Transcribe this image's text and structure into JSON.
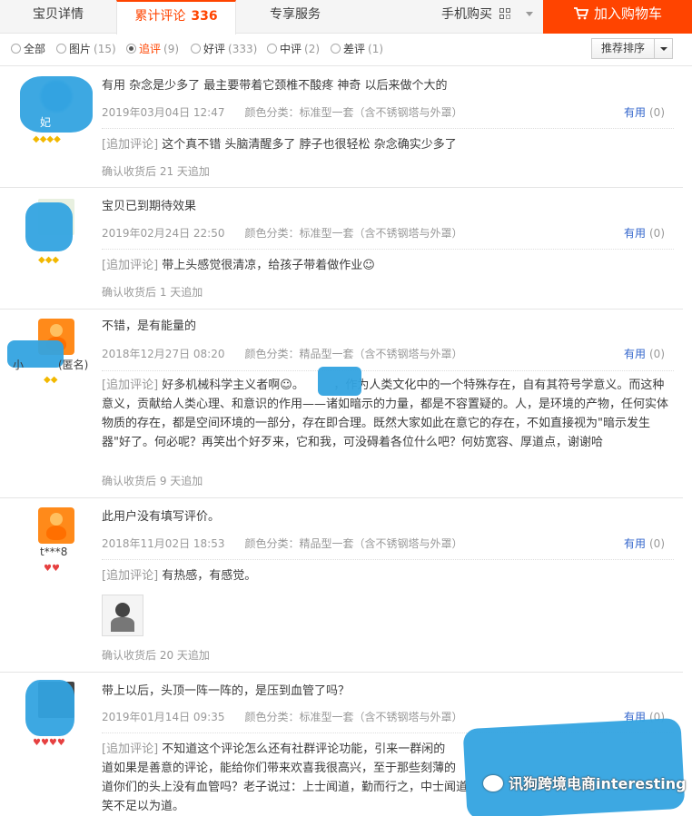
{
  "tabs": {
    "detail": "宝贝详情",
    "reviews": "累计评论",
    "reviews_count": "336",
    "service": "专享服务",
    "mobile_buy": "手机购买"
  },
  "cart_button": "加入购物车",
  "filters": [
    {
      "label": "全部",
      "count": ""
    },
    {
      "label": "图片",
      "count": "(15)"
    },
    {
      "label": "追评",
      "count": "(9)"
    },
    {
      "label": "好评",
      "count": "(333)"
    },
    {
      "label": "中评",
      "count": "(2)"
    },
    {
      "label": "差评",
      "count": "(1)"
    }
  ],
  "sort": "推荐排序",
  "useful_label": "有用",
  "reviews": [
    {
      "user": "妃",
      "text": "有用 杂念是少多了 最主要带着它颈椎不酸疼 神奇 以后来做个大的",
      "date": "2019年03月04日 12:47",
      "sku": "颜色分类：标准型一套（含不锈钢塔与外罩）",
      "useful": "(0)",
      "append_tag": "[追加评论]",
      "append": "这个真不错 头脑清醒多了 脖子也很轻松 杂念确实少多了",
      "after": "确认收货后 21 天追加"
    },
    {
      "user": "",
      "text": "宝贝已到期待效果",
      "date": "2019年02月24日 22:50",
      "sku": "颜色分类：标准型一套（含不锈钢塔与外罩）",
      "useful": "(0)",
      "append_tag": "[追加评论]",
      "append": "带上头感觉很清凉，给孩子带着做作业☺",
      "after": "确认收货后 1 天追加"
    },
    {
      "user": "小",
      "user_suffix": "(匿名)",
      "text": "不错，是有能量的",
      "date": "2018年12月27日 08:20",
      "sku": "颜色分类：精品型一套（含不锈钢塔与外罩）",
      "useful": "(0)",
      "append_tag": "[追加评论]",
      "append": "好多机械科学主义者啊☺。　　　，作为人类文化中的一个特殊存在，自有其符号学意义。而这种意义，贡献给人类心理、和意识的作用——诸如暗示的力量，都是不容置疑的。人，是环境的产物，任何实体物质的存在，都是空间环境的一部分，存在即合理。既然大家如此在意它的存在，不如直接视为\"暗示发生器\"好了。何必呢？再笑出个好歹来，它和我，可没碍着各位什么吧？何妨宽容、厚道点，谢谢哈",
      "after": "确认收货后 9 天追加"
    },
    {
      "user": "t***8",
      "text": "此用户没有填写评价。",
      "date": "2018年11月02日 18:53",
      "sku": "颜色分类：精品型一套（含不锈钢塔与外罩）",
      "useful": "(0)",
      "append_tag": "[追加评论]",
      "append": "有热感，有感觉。",
      "after": "确认收货后 20 天追加"
    },
    {
      "user": "",
      "text": "带上以后，头顶一阵一阵的，是压到血管了吗？",
      "date": "2019年01月14日 09:35",
      "sku": "颜色分类：标准型一套（含不锈钢塔与外罩）",
      "useful": "(0)",
      "append_tag": "[追加评论]",
      "append": "不知道这个评论怎么还有社群评论功能，引来一群闲的　　　　　　　　　　　　　　　　　　　　　　　　　　　道如果是善意的评论，能给你们带来欢喜我很高兴，至于那些刻薄的　　　　　　　　　　　　　　　　　　　　　　　　道你们的头上没有血管吗？老子说过：上士闻道，勤而行之，中士闻道　　　　　　　　　　　　　　　　　　　　　　　笑不足以为道。"
    }
  ],
  "watermark": "讯狗跨境电商interesting",
  "colors": {
    "accent": "#ff4400",
    "link": "#3366cc",
    "muted": "#999999"
  }
}
